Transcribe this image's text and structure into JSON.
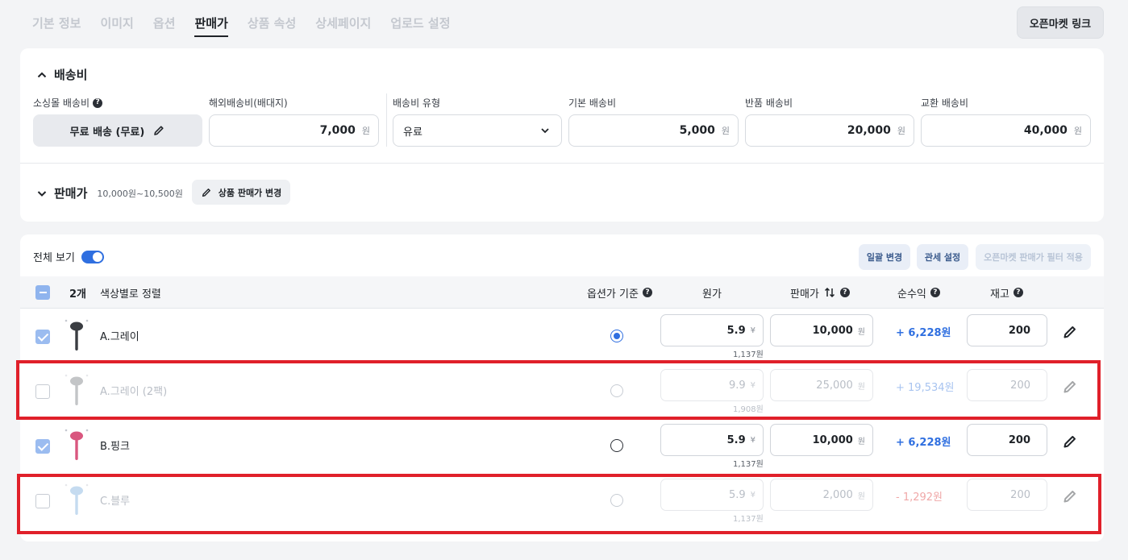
{
  "tabs": [
    {
      "label": "기본 정보",
      "active": false
    },
    {
      "label": "이미지",
      "active": false
    },
    {
      "label": "옵션",
      "active": false
    },
    {
      "label": "판매가",
      "active": true
    },
    {
      "label": "상품 속성",
      "active": false
    },
    {
      "label": "상세페이지",
      "active": false
    },
    {
      "label": "업로드 설정",
      "active": false
    }
  ],
  "open_market_link": "오픈마켓 링크",
  "shipping": {
    "title": "배송비",
    "mall_label": "소싱몰 배송비",
    "mall_value": "무료 배송 (무료)",
    "overseas_label": "해외배송비(배대지)",
    "overseas_value": "7,000",
    "type_label": "배송비 유형",
    "type_value": "유료",
    "base_label": "기본 배송비",
    "base_value": "5,000",
    "return_label": "반품 배송비",
    "return_value": "20,000",
    "exchange_label": "교환 배송비",
    "exchange_value": "40,000",
    "unit": "원"
  },
  "price": {
    "title": "판매가",
    "range": "10,000원~10,500원",
    "change_btn": "상품 판매가 변경"
  },
  "list": {
    "view_all": "전체 보기",
    "bulk_btn": "일괄 변경",
    "tax_btn": "관세 설정",
    "filter_btn": "오픈마켓 판매가 필터 적용",
    "count": "2개",
    "sort_label": "색상별로 정렬",
    "col_option_base": "옵션가 기준",
    "col_cost": "원가",
    "col_price": "판매가",
    "col_profit": "순수익",
    "col_stock": "재고",
    "cost_unit": "¥",
    "price_unit": "원",
    "rows": [
      {
        "name": "A.그레이",
        "checked": true,
        "dim": false,
        "base": true,
        "cost": "5.9",
        "cost_krw": "1,137원",
        "price": "10,000",
        "profit": "+ 6,228원",
        "negative": false,
        "stock": "200",
        "color": "#3a3d42"
      },
      {
        "name": "A.그레이 (2팩)",
        "checked": false,
        "dim": true,
        "base": false,
        "cost": "9.9",
        "cost_krw": "1,908원",
        "price": "25,000",
        "profit": "+ 19,534원",
        "negative": false,
        "stock": "200",
        "color": "#6b6f75"
      },
      {
        "name": "B.핑크",
        "checked": true,
        "dim": false,
        "base": false,
        "cost": "5.9",
        "cost_krw": "1,137원",
        "price": "10,000",
        "profit": "+ 6,228원",
        "negative": false,
        "stock": "200",
        "color": "#d9577f"
      },
      {
        "name": "C.블루",
        "checked": false,
        "dim": true,
        "base": false,
        "cost": "5.9",
        "cost_krw": "1,137원",
        "price": "2,000",
        "profit": "- 1,292원",
        "negative": true,
        "stock": "200",
        "color": "#6fa8dc"
      }
    ]
  }
}
